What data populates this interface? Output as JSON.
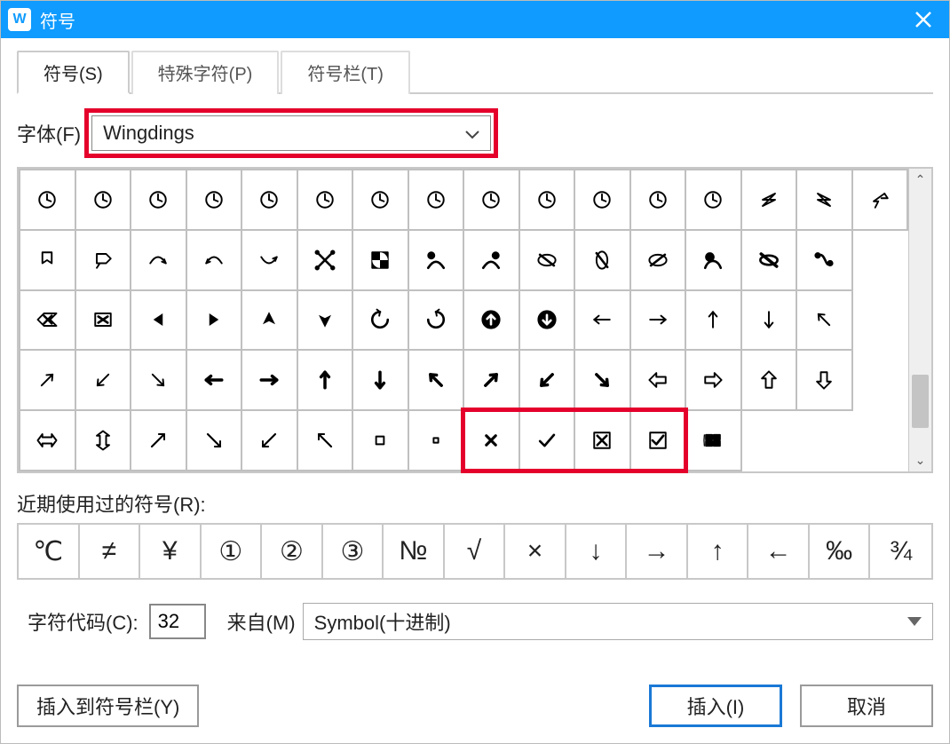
{
  "title": "符号",
  "tabs": [
    {
      "label": "符号(S)",
      "active": true
    },
    {
      "label": "特殊字符(P)",
      "active": false
    },
    {
      "label": "符号栏(T)",
      "active": false
    }
  ],
  "font_label": "字体(F)",
  "font_value": "Wingdings",
  "grid": [
    [
      "clock",
      "clock",
      "clock",
      "clock",
      "clock",
      "clock",
      "clock",
      "clock",
      "clock",
      "clock",
      "clock",
      "clock",
      "clock",
      "swoosh-l",
      "swoosh-r",
      "swoosh-back"
    ],
    [
      "ribbon",
      "ribbon2",
      "swoop1",
      "swoop2",
      "swoop3",
      "leaves",
      "pinwheel",
      "noprop1",
      "noprop2",
      "noprop3",
      "noprop4",
      "noprop5",
      "noprop6",
      "noprop7",
      "noprop8"
    ],
    [
      "boxx-a",
      "boxx-b",
      "caret-l",
      "caret-r",
      "caret-up",
      "caret-dn",
      "rot-l",
      "rot-r",
      "arr-up-bold",
      "arr-dn-bold",
      "arrow-l",
      "arrow-r",
      "arrow-u",
      "arrow-d",
      "arrow-nw"
    ],
    [
      "arrow-ne",
      "arrow-sw",
      "arrow-se",
      "arrow-l-b",
      "arrow-r-b",
      "arrow-u-b",
      "arrow-d-b",
      "arr-nw-b",
      "arr-ne-b",
      "arr-sw-b",
      "arr-se-b",
      "arrow-l-o",
      "arrow-r-o",
      "arrow-u-o",
      "arrow-d-o"
    ],
    [
      "arrow-lr-o",
      "arrow-ud-o",
      "diag-ne",
      "diag-se",
      "diag-sw",
      "diag-nw",
      "sq-big",
      "sq-sm",
      "x-mark",
      "check",
      "boxed-x",
      "boxed-check",
      "win-logo"
    ]
  ],
  "highlighted_cells": [
    "x-mark",
    "check",
    "boxed-x",
    "boxed-check"
  ],
  "recent_label": "近期使用过的符号(R):",
  "recent": [
    "℃",
    "≠",
    "¥",
    "①",
    "②",
    "③",
    "№",
    "√",
    "×",
    "↓",
    "→",
    "↑",
    "←",
    "‰",
    "¾"
  ],
  "charcode_label": "字符代码(C):",
  "charcode_value": "32",
  "from_label": "来自(M)",
  "from_value": "Symbol(十进制)",
  "btn_insert_bar": "插入到符号栏(Y)",
  "btn_insert": "插入(I)",
  "btn_cancel": "取消"
}
